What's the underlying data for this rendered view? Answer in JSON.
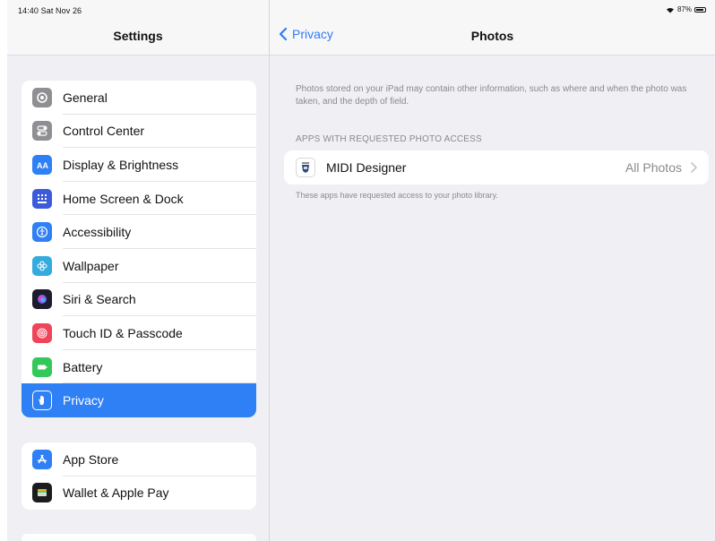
{
  "status_bar": {
    "time": "14:40",
    "date": "Sat Nov 26",
    "battery": "87%"
  },
  "sidebar": {
    "title": "Settings",
    "group1": [
      {
        "label": "General",
        "icon": "gear-icon",
        "color": "#8e8e93"
      },
      {
        "label": "Control Center",
        "icon": "toggles-icon",
        "color": "#8e8e93"
      },
      {
        "label": "Display & Brightness",
        "icon": "text-size-icon",
        "color": "#2f80f5"
      },
      {
        "label": "Home Screen & Dock",
        "icon": "app-grid-icon",
        "color": "#3b5bdb"
      },
      {
        "label": "Accessibility",
        "icon": "accessibility-icon",
        "color": "#2f80f5"
      },
      {
        "label": "Wallpaper",
        "icon": "flower-icon",
        "color": "#35aadc"
      },
      {
        "label": "Siri & Search",
        "icon": "siri-icon",
        "color": "#1c1c2e"
      },
      {
        "label": "Touch ID & Passcode",
        "icon": "fingerprint-icon",
        "color": "#f0445a"
      },
      {
        "label": "Battery",
        "icon": "battery-icon",
        "color": "#34c759"
      },
      {
        "label": "Privacy",
        "icon": "hand-icon",
        "color": "#2f80f5",
        "selected": true
      }
    ],
    "group2": [
      {
        "label": "App Store",
        "icon": "app-store-icon",
        "color": "#2f80f5"
      },
      {
        "label": "Wallet & Apple Pay",
        "icon": "wallet-icon",
        "color": "#1c1c1e"
      }
    ]
  },
  "detail": {
    "back_label": "Privacy",
    "title": "Photos",
    "info": "Photos stored on your iPad may contain other information, such as where and when the photo was taken, and the depth of field.",
    "section_header": "APPS WITH REQUESTED PHOTO ACCESS",
    "app": {
      "name": "MIDI Designer",
      "value": "All Photos"
    },
    "footer": "These apps have requested access to your photo library."
  },
  "colors": {
    "accent": "#2f7cf6",
    "background": "#efeff4",
    "secondary_text": "#8a8a8e"
  }
}
